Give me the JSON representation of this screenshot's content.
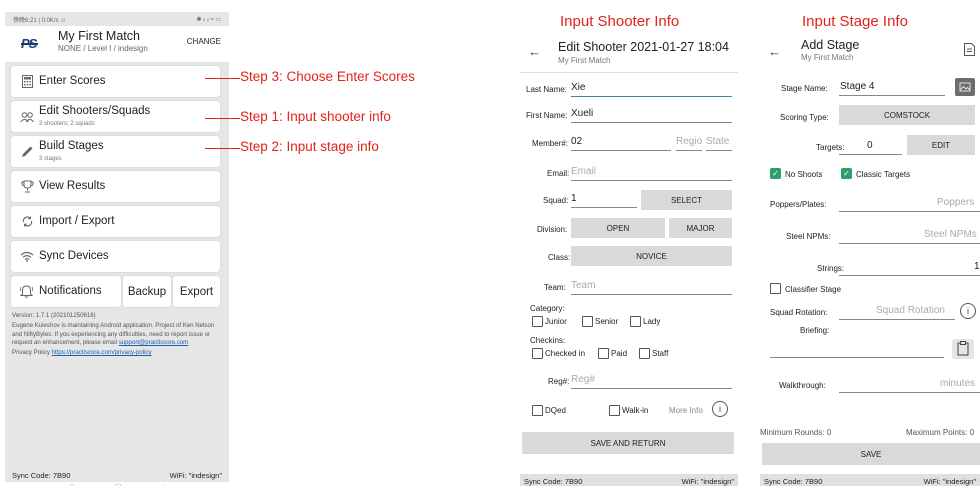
{
  "phone1": {
    "status_left": "傍晚6:21 | 0.0K/s ☺",
    "status_right": "✱ ᵢₗ ᵢₗ ≈ ▭",
    "logo": "PS",
    "title": "My First Match",
    "subtitle": "NONE / Level I / indesign",
    "change": "CHANGE",
    "enter_scores": "Enter Scores",
    "edit_shooters": "Edit Shooters/Squads",
    "edit_shooters_sub": "3 shooters; 2 squads",
    "build_stages": "Build Stages",
    "build_stages_sub": "3 stages",
    "view_results": "View Results",
    "import_export": "Import / Export",
    "sync_devices": "Sync Devices",
    "notifications": "Notifications",
    "backup": "Backup",
    "export": "Export",
    "version": "Version: 1.7.1 (202101250618)",
    "info_text": "Eugene Kuleshov is maintaining Android application. Project of Ken Nelson and NiftyBytes. If you experiencing any difficulties, need to report issue or request an enhancement, please email",
    "support_email": "support@practiscore.com",
    "privacy_label": "Privacy Policy",
    "privacy_url": "https://practiscore.com/privacy-policy",
    "sync_code": "Sync Code: 7B90",
    "wifi": "WiFi: \"indesign\"",
    "nav": [
      "≡",
      "▢",
      "‹"
    ]
  },
  "annotations": {
    "step3": "Step 3: Choose Enter Scores",
    "step1": "Step 1: Input shooter info",
    "step2": "Step 2: Input stage info",
    "shooter_title": "Input Shooter Info",
    "stage_title": "Input Stage Info"
  },
  "phone2": {
    "back": "←",
    "title": "Edit Shooter 2021-01-27 18:04",
    "subtitle": "My First Match",
    "last_name_label": "Last Name:",
    "last_name": "Xie",
    "first_name_label": "First Name:",
    "first_name": "Xueli",
    "member_label": "Member#:",
    "member": "02",
    "region_ph": "Regio",
    "state_ph": "State",
    "email_label": "Email:",
    "email_ph": "Email",
    "squad_label": "Squad:",
    "squad": "1",
    "select": "SELECT",
    "division_label": "Division:",
    "open": "OPEN",
    "major": "MAJOR",
    "class_label": "Class:",
    "novice": "NOVICE",
    "team_label": "Team:",
    "team_ph": "Team",
    "category_label": "Category:",
    "junior": "Junior",
    "senior": "Senior",
    "lady": "Lady",
    "checkins_label": "Checkins:",
    "checked_in": "Checked in",
    "paid": "Paid",
    "staff": "Staff",
    "reg_label": "Reg#:",
    "reg_ph": "Reg#",
    "dqed": "DQed",
    "walkin": "Walk-in",
    "more_info": "More Info",
    "save_return": "SAVE AND RETURN",
    "sync_code": "Sync Code: 7B90",
    "wifi": "WiFi: \"indesign\""
  },
  "phone3": {
    "back": "←",
    "title": "Add Stage",
    "subtitle": "My First Match",
    "stage_name_label": "Stage Name:",
    "stage_name": "Stage 4",
    "scoring_type_label": "Scoring Type:",
    "comstock": "COMSTOCK",
    "targets_label": "Targets:",
    "targets": "0",
    "edit": "EDIT",
    "no_shoots": "No Shoots",
    "classic_targets": "Classic Targets",
    "poppers_label": "Poppers/Plates:",
    "poppers_ph": "Poppers",
    "steel_label": "Steel NPMs:",
    "steel_ph": "Steel NPMs",
    "strings_label": "Strings:",
    "strings": "1",
    "classifier_stage": "Classifier Stage",
    "squad_rotation_label": "Squad Rotation:",
    "squad_rotation_ph": "Squad Rotation",
    "briefing_label": "Briefing:",
    "walkthrough_label": "Walkthrough:",
    "walkthrough_ph": "minutes",
    "min_rounds": "Minimum Rounds: 0",
    "max_points": "Maximum Points: 0",
    "save": "SAVE",
    "sync_code": "Sync Code: 7B90",
    "wifi": "WiFi: \"indesign\""
  },
  "colors": {
    "accent_red": "#e3231a",
    "check_green": "#2e9e6a",
    "logo_blue": "#1e3a73"
  }
}
